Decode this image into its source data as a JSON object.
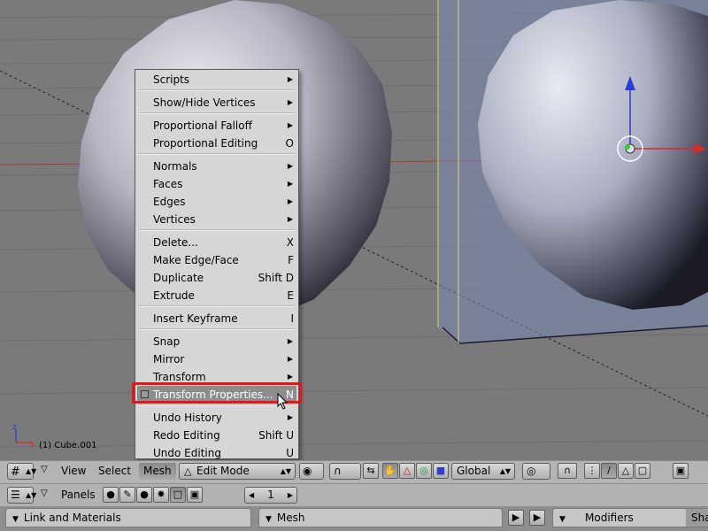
{
  "viewport": {
    "object_label": "(1) Cube.001"
  },
  "menu": {
    "items": [
      {
        "label": "Scripts",
        "shortcut": "",
        "submenu": true
      },
      {
        "label": "Show/Hide Vertices",
        "shortcut": "",
        "submenu": true
      },
      {
        "label": "Proportional Falloff",
        "shortcut": "",
        "submenu": true
      },
      {
        "label": "Proportional Editing",
        "shortcut": "O",
        "submenu": false
      },
      {
        "label": "Normals",
        "shortcut": "",
        "submenu": true
      },
      {
        "label": "Faces",
        "shortcut": "",
        "submenu": true
      },
      {
        "label": "Edges",
        "shortcut": "",
        "submenu": true
      },
      {
        "label": "Vertices",
        "shortcut": "",
        "submenu": true
      },
      {
        "label": "Delete...",
        "shortcut": "X",
        "submenu": false
      },
      {
        "label": "Make Edge/Face",
        "shortcut": "F",
        "submenu": false
      },
      {
        "label": "Duplicate",
        "shortcut": "Shift D",
        "submenu": false
      },
      {
        "label": "Extrude",
        "shortcut": "E",
        "submenu": false
      },
      {
        "label": "Insert Keyframe",
        "shortcut": "I",
        "submenu": false
      },
      {
        "label": "Snap",
        "shortcut": "",
        "submenu": true
      },
      {
        "label": "Mirror",
        "shortcut": "",
        "submenu": true
      },
      {
        "label": "Transform",
        "shortcut": "",
        "submenu": true
      },
      {
        "label": "Transform Properties...",
        "shortcut": "N",
        "submenu": false,
        "active": true
      },
      {
        "label": "Undo History",
        "shortcut": "",
        "submenu": true
      },
      {
        "label": "Redo Editing",
        "shortcut": "Shift U",
        "submenu": false
      },
      {
        "label": "Undo Editing",
        "shortcut": "U",
        "submenu": false
      }
    ]
  },
  "header": {
    "view_label": "View",
    "select_label": "Select",
    "mesh_label": "Mesh",
    "mode_label": "Edit Mode",
    "orientation_label": "Global"
  },
  "buttons": {
    "panels_label": "Panels",
    "frame_value": "1"
  },
  "panels": {
    "link_materials": "Link and Materials",
    "mesh": "Mesh",
    "modifiers_tab": "Modifiers",
    "shapes_tab": "Sha"
  },
  "colors": {
    "highlight": "#e8141c",
    "viewport_bg": "#7a7a7a",
    "menu_bg": "#d6d6d6"
  }
}
